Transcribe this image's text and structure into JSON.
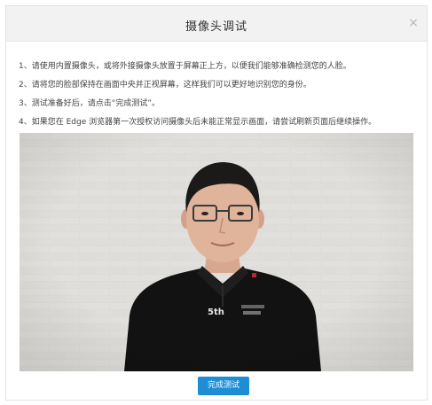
{
  "dialog": {
    "title": "摄像头调试",
    "close_glyph": "×"
  },
  "instructions": [
    "1、请使用内置摄像头，或将外接摄像头放置于屏幕正上方，以便我们能够准确检测您的人脸。",
    "2、请将您的脸部保持在画面中央并正视屏幕，这样我们可以更好地识别您的身份。",
    "3、测试准备好后，请点击“完成测试”。",
    "4、如果您在 Edge 浏览器第一次授权访问摄像头后未能正常显示画面，请尝试刷新页面后继续操作。"
  ],
  "video": {
    "shirt_badge_text": "5th"
  },
  "finish_button": {
    "label": "完成测试"
  },
  "colors": {
    "header_bg": "#f2f2f2",
    "button_bg": "#1d8dd6",
    "wall": "#dcdad6",
    "shirt": "#111111"
  },
  "icons": {
    "close": "close-icon"
  }
}
